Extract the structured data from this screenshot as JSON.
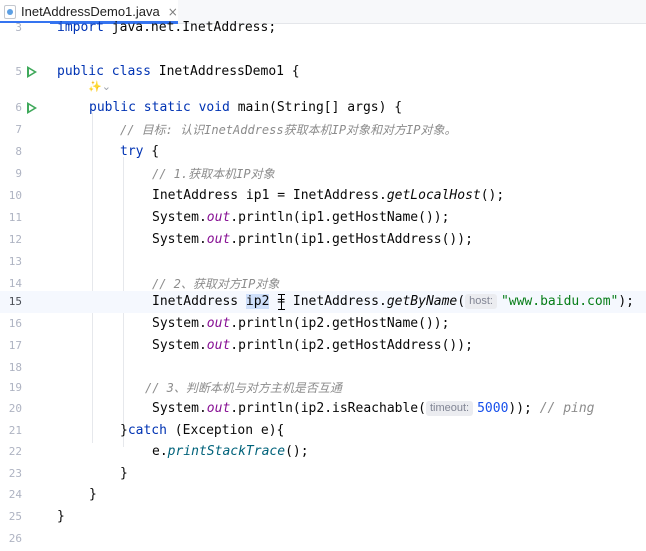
{
  "tab": {
    "title": "InetAddressDemo1.java",
    "close_glyph": "×"
  },
  "ai_hint": "✨⌄",
  "code": {
    "l3": {
      "n": "3",
      "kw": "import",
      "rest": " java.net.InetAddress;"
    },
    "l5": {
      "n": "5",
      "kw": "public class",
      "rest": " InetAddressDemo1 {"
    },
    "l6": {
      "n": "6",
      "kw": "public static void",
      "rest": " main(String[] args) {"
    },
    "l7": {
      "n": "7",
      "cm": "// 目标: 认识InetAddress获取本机IP对象和对方IP对象。"
    },
    "l8": {
      "n": "8",
      "kw": "try",
      "rest": " {"
    },
    "l9": {
      "n": "9",
      "cm": "// 1.获取本机IP对象"
    },
    "l10": {
      "n": "10",
      "a": "InetAddress ip1 = InetAddress.",
      "m": "getLocalHost",
      "b": "();"
    },
    "l11": {
      "n": "11",
      "a": "System.",
      "f": "out",
      "b": ".println(ip1.getHostName());"
    },
    "l12": {
      "n": "12",
      "a": "System.",
      "f": "out",
      "b": ".println(ip1.getHostAddress());"
    },
    "l13": {
      "n": "13"
    },
    "l14": {
      "n": "14",
      "cm": "// 2、获取对方IP对象"
    },
    "l15": {
      "n": "15",
      "a": "InetAddress ",
      "sel": "ip2",
      "b": " = InetAddress.",
      "m": "getByName",
      "c": "(",
      "hint": "host:",
      "s": "\"www.baidu.com\"",
      "d": ");"
    },
    "l16": {
      "n": "16",
      "a": "System.",
      "f": "out",
      "b": ".println(ip2.getHostName());"
    },
    "l17": {
      "n": "17",
      "a": "System.",
      "f": "out",
      "b": ".println(ip2.getHostAddress());"
    },
    "l18": {
      "n": "18"
    },
    "l19": {
      "n": "19",
      "cm": "// 3、判断本机与对方主机是否互通"
    },
    "l20": {
      "n": "20",
      "a": "System.",
      "f": "out",
      "b": ".println(ip2.isReachable(",
      "hint": "timeout:",
      "num": "5000",
      "c": ")); ",
      "cm": "// ping"
    },
    "l21": {
      "n": "21",
      "a": "}",
      "kw": "catch",
      "b": " (Exception e){"
    },
    "l22": {
      "n": "22",
      "a": "e.",
      "m": "printStackTrace",
      "b": "();"
    },
    "l23": {
      "n": "23",
      "a": "}"
    },
    "l24": {
      "n": "24",
      "a": "}"
    },
    "l25": {
      "n": "25",
      "a": "}"
    },
    "l26": {
      "n": "26"
    }
  },
  "colors": {
    "keyword": "#0033b3",
    "string": "#067d17",
    "number": "#1750eb",
    "comment": "#8c8c8c",
    "run": "#3fa95b",
    "tab_accent": "#3574f0"
  }
}
